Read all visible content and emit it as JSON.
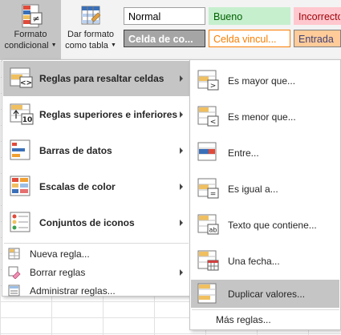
{
  "ribbon": {
    "formato_condicional": {
      "line1": "Formato",
      "line2": "condicional"
    },
    "dar_formato_tabla": {
      "line1": "Dar formato",
      "line2": "como tabla"
    },
    "styles": [
      {
        "label": "Normal",
        "bg": "#ffffff",
        "fg": "#000000",
        "border": "#9e9e9e"
      },
      {
        "label": "Bueno",
        "bg": "#c6efce",
        "fg": "#006100",
        "border": "#c6efce"
      },
      {
        "label": "Incorrecto",
        "bg": "#ffc7ce",
        "fg": "#9c0006",
        "border": "#ffc7ce"
      },
      {
        "label": "Celda de co...",
        "bg": "#a5a5a5",
        "fg": "#ffffff",
        "border": "#3f3f3f"
      },
      {
        "label": "Celda vincul...",
        "bg": "#ffffff",
        "fg": "#fa7d00",
        "border": "#fa7d00"
      },
      {
        "label": "Entrada",
        "bg": "#ffcc99",
        "fg": "#3f3f76",
        "border": "#7f7f7f"
      }
    ]
  },
  "main_menu": {
    "items": [
      {
        "label": "Reglas para resaltar celdas",
        "icon": "highlight-rules-icon",
        "has_submenu": true
      },
      {
        "label": "Reglas superiores e inferiores",
        "icon": "top-bottom-rules-icon",
        "has_submenu": true
      },
      {
        "label": "Barras de datos",
        "icon": "data-bars-icon",
        "has_submenu": true
      },
      {
        "label": "Escalas de color",
        "icon": "color-scales-icon",
        "has_submenu": true
      },
      {
        "label": "Conjuntos de iconos",
        "icon": "icon-sets-icon",
        "has_submenu": true
      }
    ],
    "small_items": [
      {
        "label": "Nueva regla...",
        "icon": "new-rule-icon",
        "has_submenu": false
      },
      {
        "label": "Borrar reglas",
        "icon": "clear-rules-icon",
        "has_submenu": true
      },
      {
        "label": "Administrar reglas...",
        "icon": "manage-rules-icon",
        "has_submenu": false
      }
    ]
  },
  "submenu": {
    "items": [
      {
        "label": "Es mayor que...",
        "icon": "greater-than-icon"
      },
      {
        "label": "Es menor que...",
        "icon": "less-than-icon"
      },
      {
        "label": "Entre...",
        "icon": "between-icon"
      },
      {
        "label": "Es igual a...",
        "icon": "equal-to-icon"
      },
      {
        "label": "Texto que contiene...",
        "icon": "text-contains-icon"
      },
      {
        "label": "Una fecha...",
        "icon": "date-occurring-icon"
      },
      {
        "label": "Duplicar valores...",
        "icon": "duplicate-values-icon"
      }
    ],
    "more": "Más reglas..."
  },
  "colors": {
    "highlight": "#c5c5c5",
    "icon_orange": "#f0c060",
    "icon_blue": "#3a6fb8",
    "icon_red": "#d04040"
  }
}
